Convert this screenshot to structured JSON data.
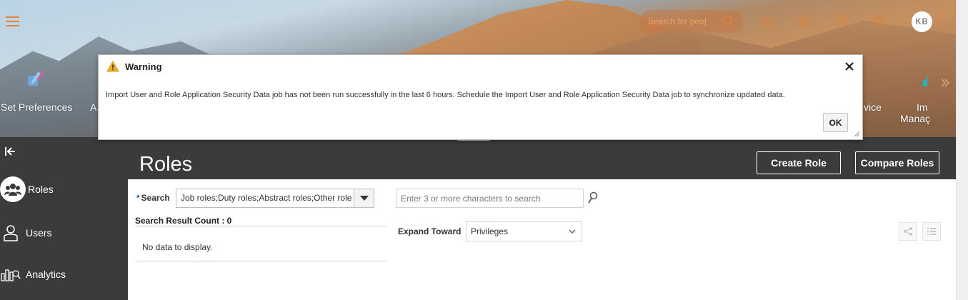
{
  "header": {
    "search_placeholder": "Search for peo|",
    "avatar_initials": "KB",
    "icons": [
      "home-icon",
      "star-icon",
      "flag-icon",
      "bell-icon"
    ]
  },
  "quick_actions": {
    "set_preferences": "Set Preferences",
    "partial_a": "A",
    "partial_service": "vice",
    "partial_im": "Im",
    "partial_manag": "Manaç"
  },
  "modal": {
    "title": "Warning",
    "message": "Import User and Role Application Security Data job has not been run successfully in the last 6 hours. Schedule the Import User and Role Application Security Data job to synchronize updated data.",
    "ok_label": "OK"
  },
  "sidebar": {
    "items": [
      {
        "label": "Roles",
        "icon": "roles-icon",
        "active": true
      },
      {
        "label": "Users",
        "icon": "users-icon",
        "active": false
      },
      {
        "label": "Analytics",
        "icon": "analytics-icon",
        "active": false
      }
    ]
  },
  "page": {
    "title": "Roles",
    "create_role": "Create Role",
    "compare_roles": "Compare Roles"
  },
  "search": {
    "label": "Search",
    "required_marker": "*",
    "role_types_value": "Job roles;Duty roles;Abstract roles;Other role",
    "input_placeholder": "Enter 3 or more characters to search",
    "result_count_label": "Search Result Count : 0",
    "no_data": "No data to display."
  },
  "expand": {
    "label": "Expand Toward",
    "value": "Privileges"
  },
  "colors": {
    "accent_orange": "#e0823a",
    "dark_band": "#3b3b3b",
    "required_blue": "#1a61a8",
    "warning_yellow": "#f2b01e"
  }
}
